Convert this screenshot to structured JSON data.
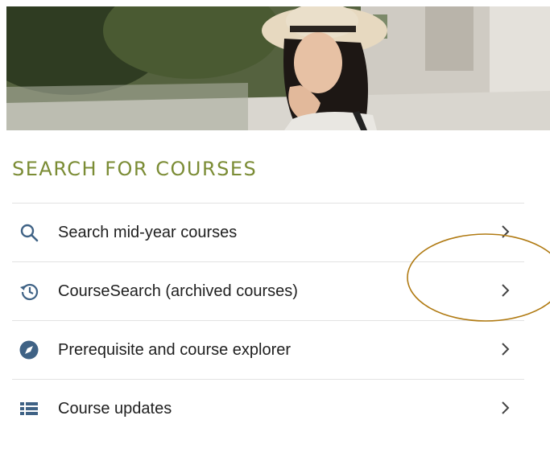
{
  "section": {
    "title": "SEARCH FOR COURSES",
    "accent_color": "#7b8c35"
  },
  "items": [
    {
      "label": "Search mid-year courses",
      "icon": "search-icon"
    },
    {
      "label": "CourseSearch (archived courses)",
      "icon": "history-icon"
    },
    {
      "label": "Prerequisite and course explorer",
      "icon": "compass-icon"
    },
    {
      "label": "Course updates",
      "icon": "list-icon"
    }
  ],
  "colors": {
    "icon_blue": "#3f6285",
    "annotation": "#b07a12",
    "divider": "#e2e2e2"
  }
}
